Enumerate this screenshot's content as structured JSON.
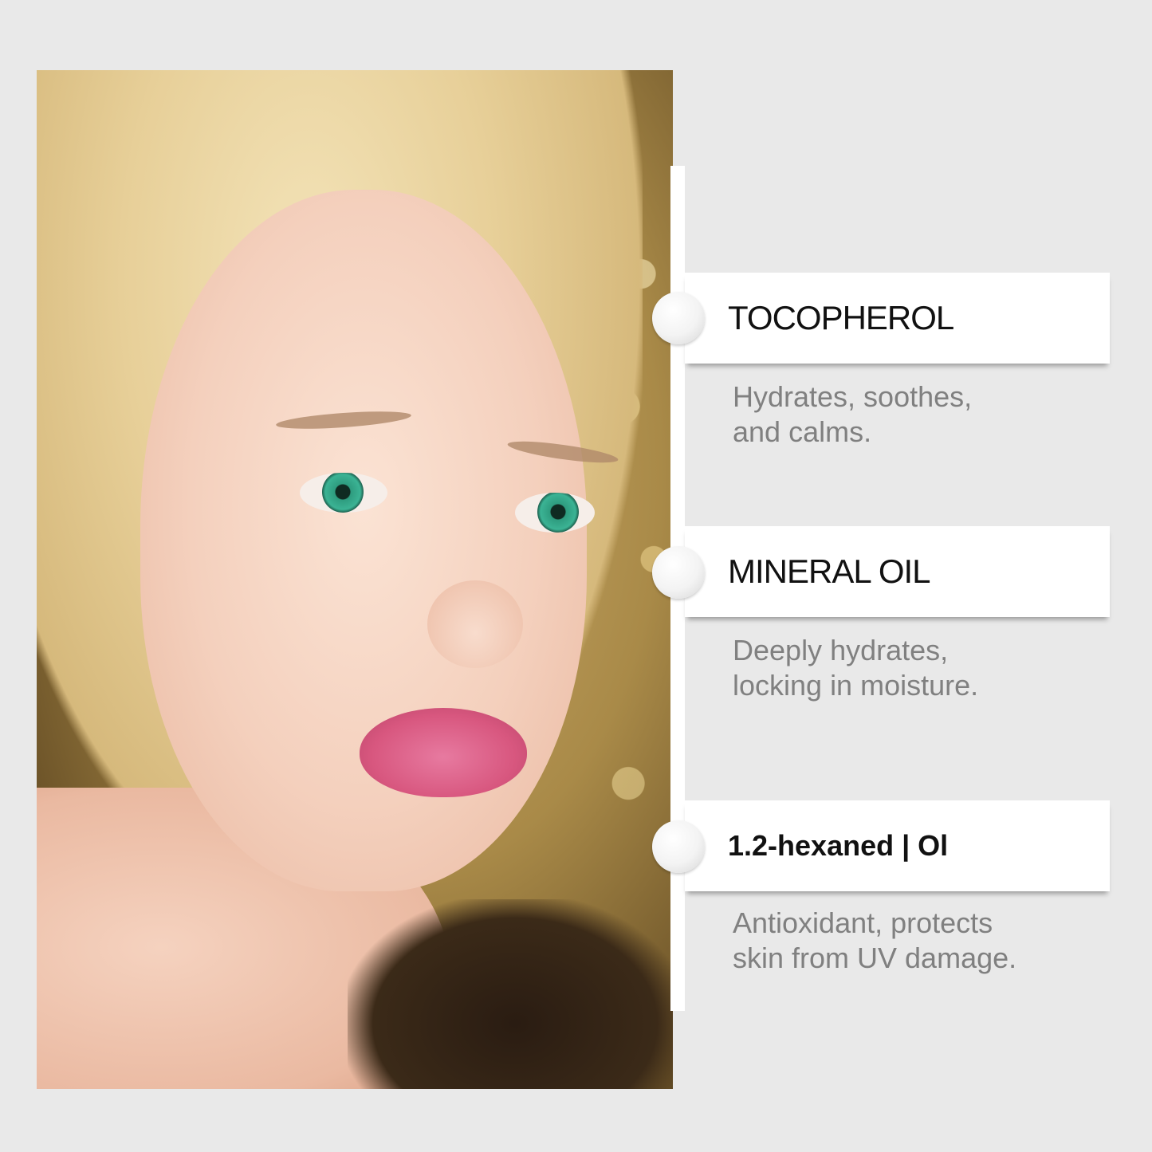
{
  "ingredients": [
    {
      "name": "TOCOPHEROL",
      "description_line1": "Hydrates, soothes,",
      "description_line2": "and calms."
    },
    {
      "name": "MINERAL OIL",
      "description_line1": "Deeply hydrates,",
      "description_line2": "locking in moisture."
    },
    {
      "name": "1.2-hexaned | Ol",
      "description_line1": "Antioxidant, protects",
      "description_line2": "skin from UV damage."
    }
  ],
  "colors": {
    "background": "#e9e9e9",
    "card": "#ffffff",
    "title_text": "#111111",
    "description_text": "#808080"
  }
}
